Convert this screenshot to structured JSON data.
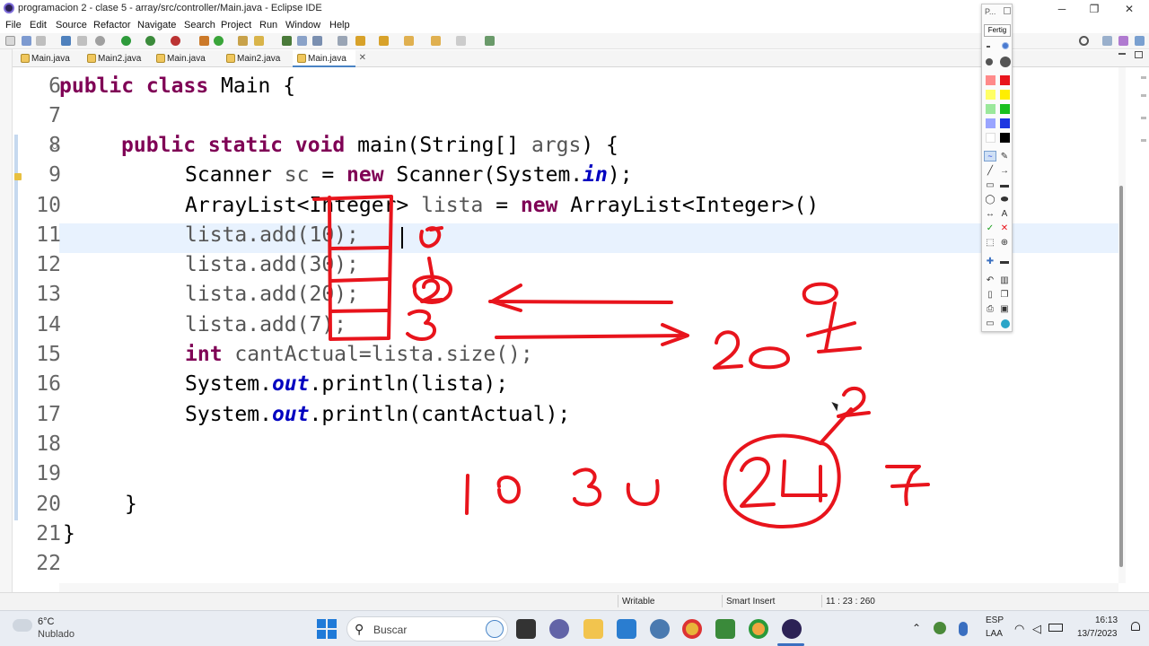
{
  "window": {
    "title": "programacion 2 - clase 5 - array/src/controller/Main.java - Eclipse IDE",
    "minimize": "─",
    "maximize": "❐",
    "close": "✕"
  },
  "menu": [
    "File",
    "Edit",
    "Source",
    "Refactor",
    "Navigate",
    "Search",
    "Project",
    "Run",
    "Window",
    "Help"
  ],
  "tabs": [
    {
      "label": "Main.java",
      "active": false
    },
    {
      "label": "Main2.java",
      "active": false
    },
    {
      "label": "Main.java",
      "active": false
    },
    {
      "label": "Main2.java",
      "active": false
    },
    {
      "label": "Main.java",
      "active": true
    }
  ],
  "tab_close": "✕",
  "code_lines": [
    {
      "num": "6"
    },
    {
      "num": "7"
    },
    {
      "num": "8"
    },
    {
      "num": "9"
    },
    {
      "num": "10"
    },
    {
      "num": "11"
    },
    {
      "num": "12"
    },
    {
      "num": "13"
    },
    {
      "num": "14"
    },
    {
      "num": "15"
    },
    {
      "num": "16"
    },
    {
      "num": "17"
    },
    {
      "num": "18"
    },
    {
      "num": "19"
    },
    {
      "num": "20"
    },
    {
      "num": "21"
    },
    {
      "num": "22"
    }
  ],
  "code": {
    "l6_kw": "public class",
    "l6_rest": " Main {",
    "l8_kw": "public static void",
    "l8_rest": " main(String[] ",
    "l8_args": "args",
    "l8_end": ") {",
    "l9_a": "Scanner ",
    "l9_sc": "sc",
    "l9_b": " = ",
    "l9_new": "new",
    "l9_c": " Scanner(System.",
    "l9_in": "in",
    "l9_d": ");",
    "l10_a": "ArrayList<Integer> ",
    "l10_lista": "lista",
    "l10_b": " = ",
    "l10_new": "new",
    "l10_c": " ArrayList<Integer>()",
    "l11": "lista.add(10);",
    "l12": "lista.add(30);",
    "l13": "lista.add(20);",
    "l14": "lista.add(7);",
    "l15_int": "int",
    "l15_b": " ",
    "l15_var": "cantActual",
    "l15_c": "=lista.size();",
    "l16_a": "System.",
    "l16_out": "out",
    "l16_b": ".println(lista);",
    "l17_a": "System.",
    "l17_out": "out",
    "l17_b": ".println(cantActual);",
    "l20": "}",
    "l21": "}"
  },
  "status": {
    "writable": "Writable",
    "insert": "Smart Insert",
    "position": "11 : 23 : 260"
  },
  "taskbar": {
    "temp": "6°C",
    "weather": "Nublado",
    "search_placeholder": "Buscar",
    "lang1": "ESP",
    "lang2": "LAA",
    "time": "16:13",
    "date": "13/7/2023"
  },
  "palette": {
    "header": "P...",
    "button": "Fertig",
    "ink_color": "#e8141c",
    "colors": [
      "#ff8a8a",
      "#e8141c",
      "#ffff66",
      "#ffee00",
      "#9be89b",
      "#19c01d",
      "#9aa5ff",
      "#1e37e0",
      "#ffffff",
      "#000000"
    ]
  }
}
